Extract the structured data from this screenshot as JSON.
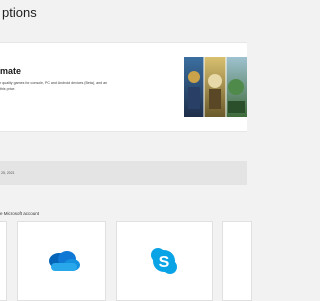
{
  "page": {
    "title": "ptions"
  },
  "subscription": {
    "name": "mate",
    "description_line1": "r quality games for console, PC and Android devices (Beta), and an",
    "description_line2": "this price."
  },
  "billing": {
    "date_text": "25, 2021"
  },
  "benefits": {
    "title": "e Microsoft account",
    "tiles": [
      {
        "icon": "onedrive-icon"
      },
      {
        "icon": "skype-icon"
      }
    ]
  },
  "colors": {
    "onedrive_blue": "#0f78d4",
    "skype_blue": "#0aa3e6"
  }
}
